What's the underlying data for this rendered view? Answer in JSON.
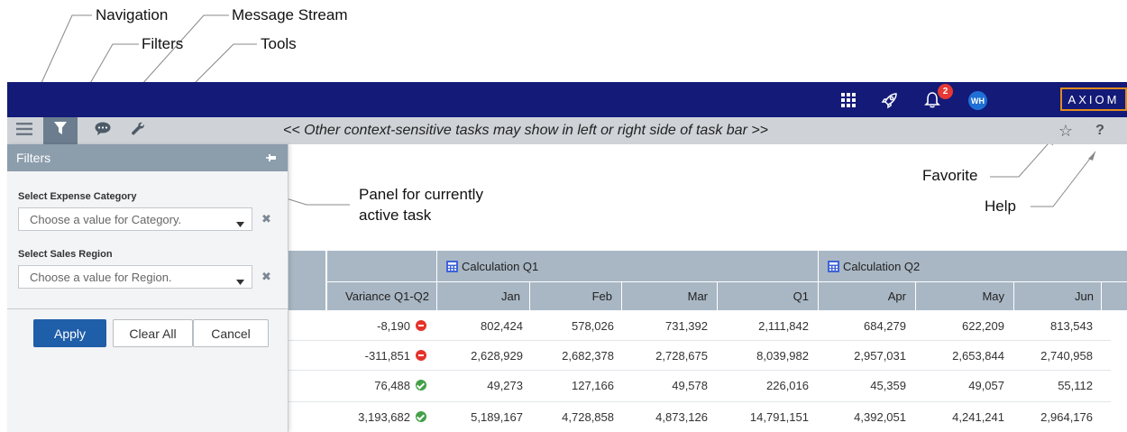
{
  "annotations": {
    "navigation": "Navigation",
    "filters": "Filters",
    "message_stream": "Message Stream",
    "tools": "Tools",
    "favorite": "Favorite",
    "help": "Help",
    "panel_line1": "Panel for currently",
    "panel_line2": "active task"
  },
  "topbar": {
    "notification_count": "2",
    "user_initials": "WH",
    "logo_text": "AXIOM",
    "icons": [
      "apps-grid-icon",
      "rocket-icon",
      "bell-icon"
    ]
  },
  "taskbar": {
    "icons": [
      "menu-icon",
      "filter-icon",
      "message-icon",
      "wrench-icon"
    ],
    "message": "<< Other context-sensitive tasks may show in left or right side of task bar >>",
    "favorite_symbol": "☆",
    "help_symbol": "?"
  },
  "filters_panel": {
    "title": "Filters",
    "fields": [
      {
        "label": "Select Expense Category",
        "placeholder": "Choose a value for Category."
      },
      {
        "label": "Select Sales Region",
        "placeholder": "Choose a value for Region."
      }
    ],
    "buttons": {
      "apply": "Apply",
      "clear_all": "Clear All",
      "cancel": "Cancel"
    }
  },
  "grid": {
    "groups": [
      "Calculation Q1",
      "Calculation Q2"
    ],
    "variance_header": "Variance Q1-Q2",
    "columns": [
      "Jan",
      "Feb",
      "Mar",
      "Q1",
      "Apr",
      "May",
      "Jun"
    ],
    "rows": [
      {
        "variance": "-8,190",
        "status": "negative",
        "values": [
          "802,424",
          "578,026",
          "731,392",
          "2,111,842",
          "684,279",
          "622,209",
          "813,543"
        ]
      },
      {
        "variance": "-311,851",
        "status": "negative",
        "values": [
          "2,628,929",
          "2,682,378",
          "2,728,675",
          "8,039,982",
          "2,957,031",
          "2,653,844",
          "2,740,958"
        ]
      },
      {
        "variance": "76,488",
        "status": "positive",
        "values": [
          "49,273",
          "127,166",
          "49,578",
          "226,016",
          "45,359",
          "49,057",
          "55,112"
        ]
      },
      {
        "variance": "3,193,682",
        "status": "positive",
        "values": [
          "5,189,167",
          "4,728,858",
          "4,873,126",
          "14,791,151",
          "4,392,051",
          "4,241,241",
          "2,964,176"
        ]
      }
    ]
  },
  "colors": {
    "topbar": "#131a78",
    "taskbar": "#cfd3d7",
    "active_task": "#6b7d8e",
    "panel_header": "#8c9dac",
    "apply_button": "#1f5ea8",
    "grid_header": "#a9b7c4",
    "logo_border": "#e08a1e",
    "negative": "#e5332a",
    "positive": "#43a047"
  }
}
